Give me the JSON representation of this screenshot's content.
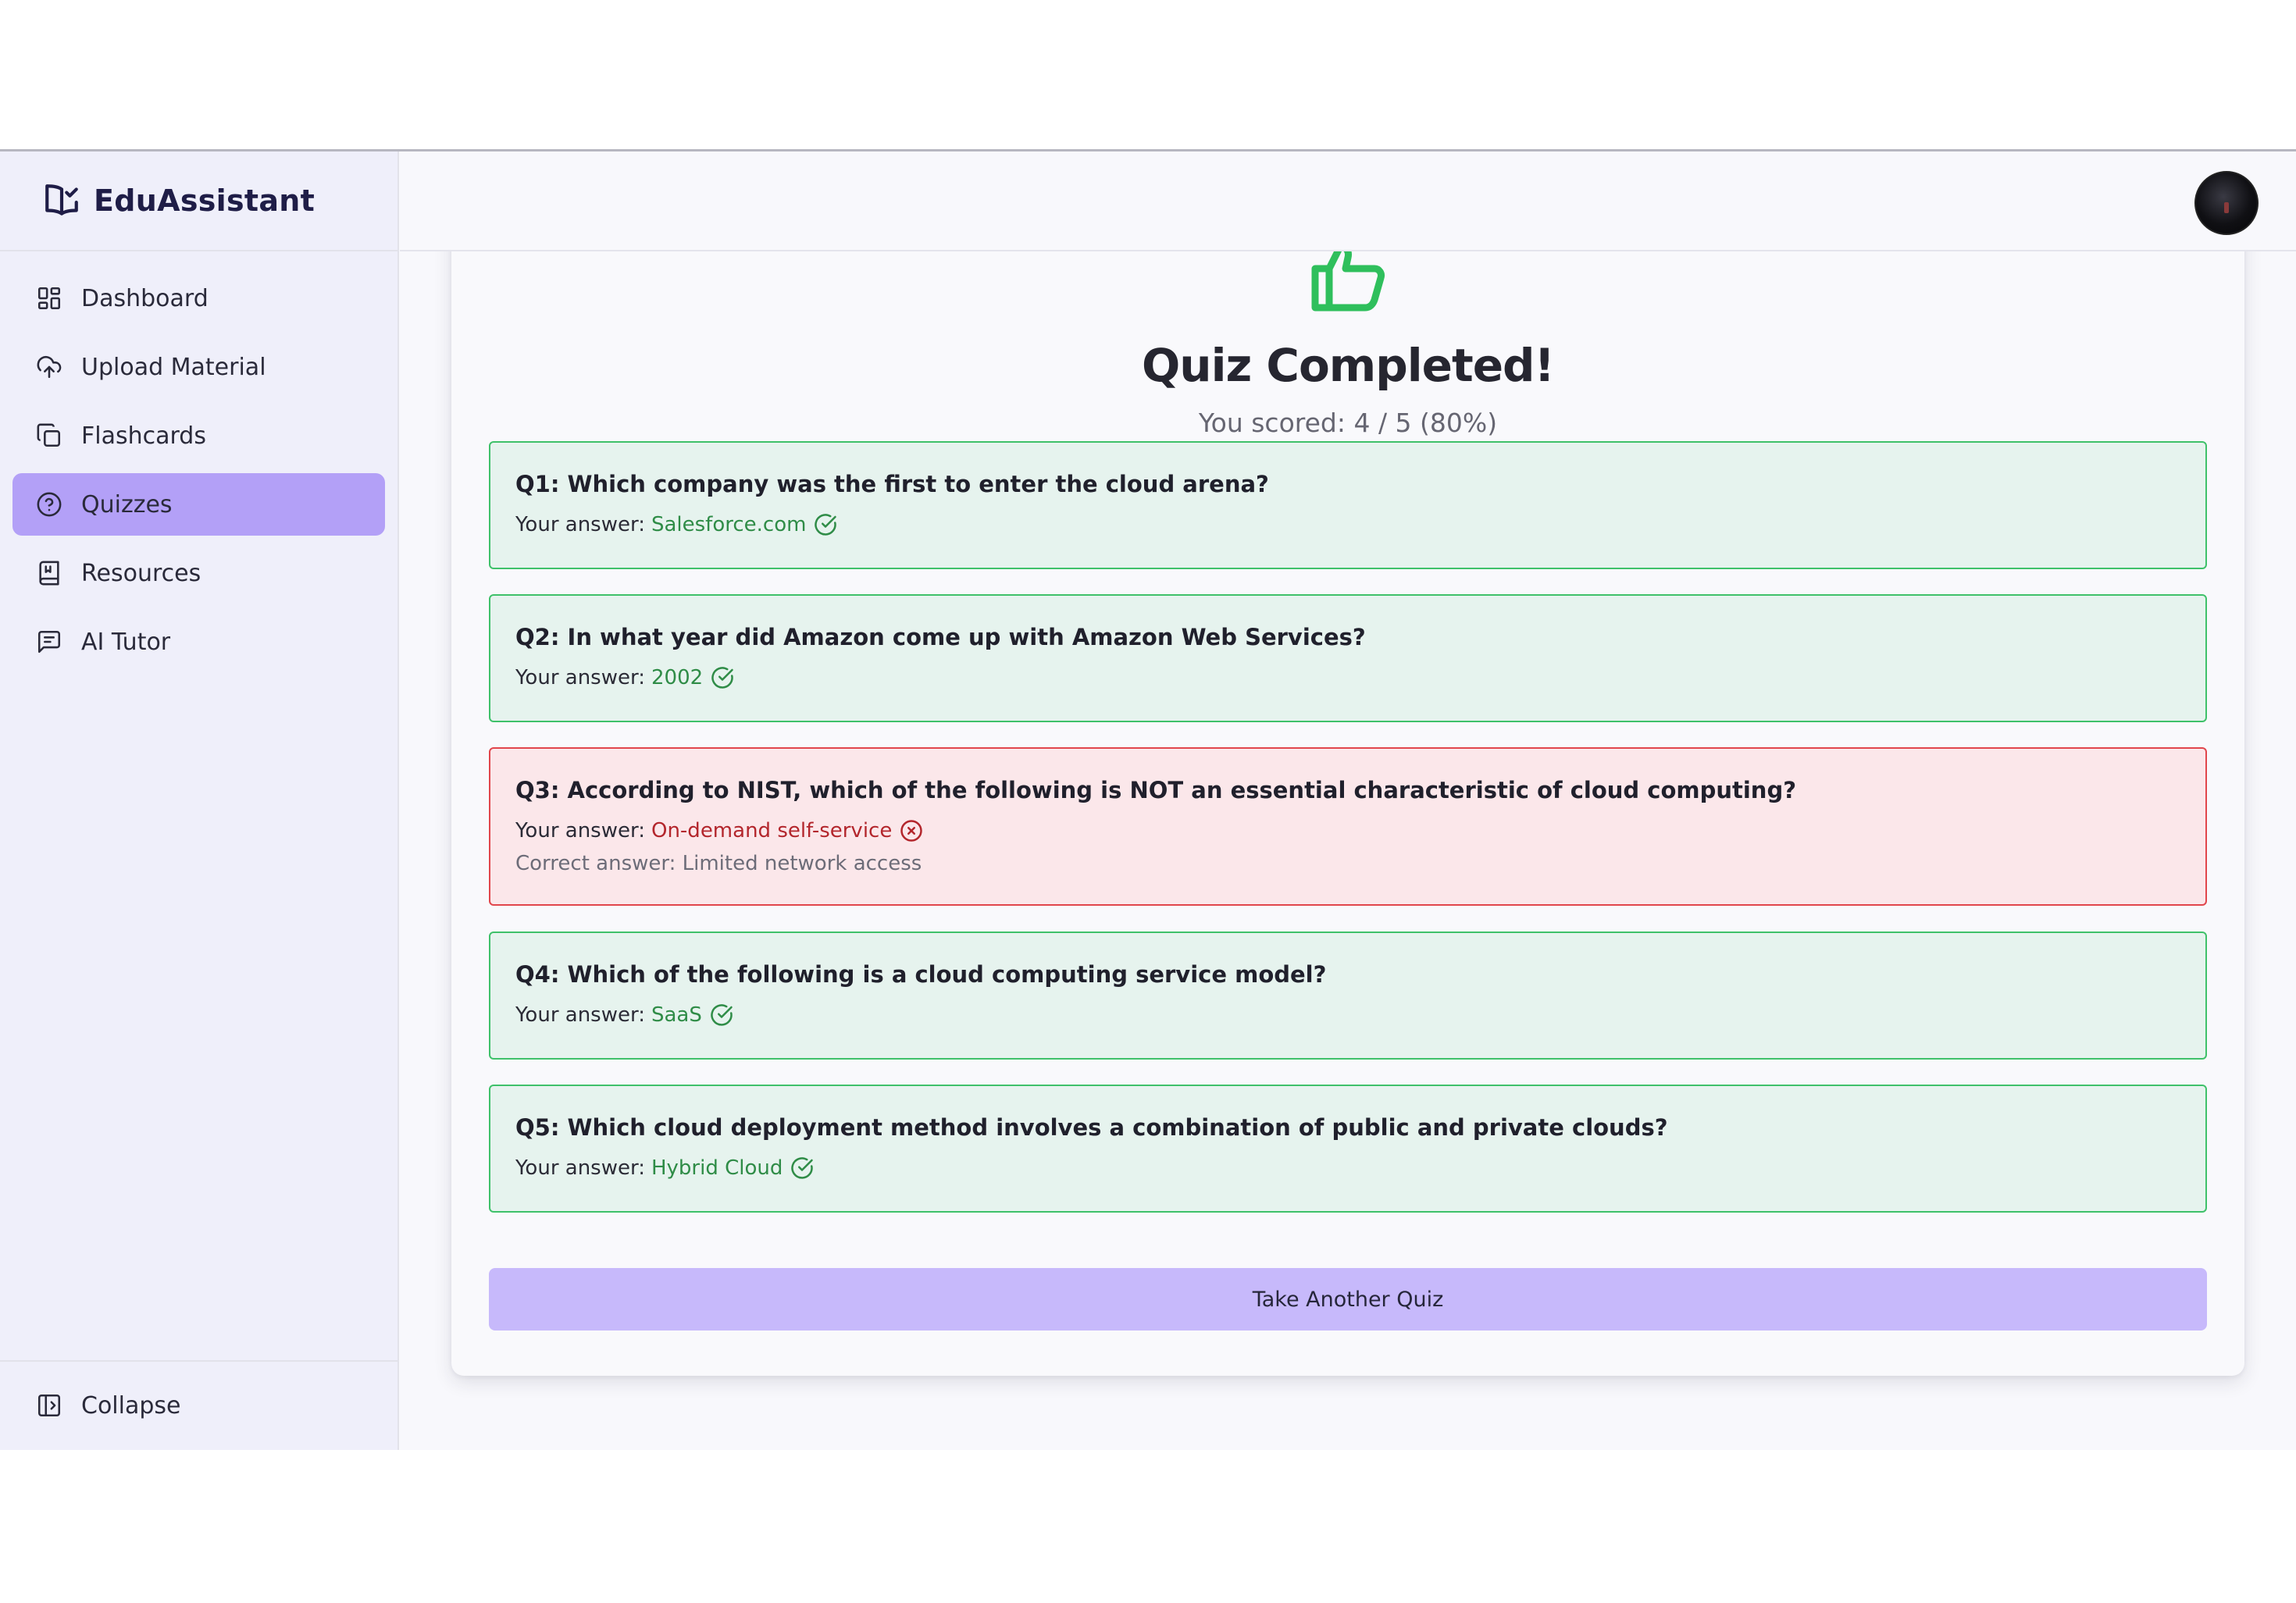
{
  "app": {
    "name": "EduAssistant",
    "logo_icon": "book-check-icon"
  },
  "sidebar": {
    "items": [
      {
        "label": "Dashboard",
        "icon": "dashboard-icon",
        "active": false
      },
      {
        "label": "Upload Material",
        "icon": "cloud-upload-icon",
        "active": false
      },
      {
        "label": "Flashcards",
        "icon": "copy-icon",
        "active": false
      },
      {
        "label": "Quizzes",
        "icon": "help-circle-icon",
        "active": true
      },
      {
        "label": "Resources",
        "icon": "book-icon",
        "active": false
      },
      {
        "label": "AI Tutor",
        "icon": "message-icon",
        "active": false
      }
    ],
    "collapse_label": "Collapse"
  },
  "colors": {
    "active_nav": "#b3a0f7",
    "correct_border": "#3fc16a",
    "correct_bg": "#e6f3ee",
    "wrong_border": "#e1464c",
    "wrong_bg": "#fbe7ea",
    "button": "#c7b9fb"
  },
  "quiz": {
    "title": "Quiz Completed!",
    "score_text": "You scored: 4 / 5 (80%)",
    "your_answer_label": "Your answer:",
    "questions": [
      {
        "text": "Q1: Which company was the first to enter the cloud arena?",
        "answer": "Salesforce.com",
        "correct": true
      },
      {
        "text": "Q2: In what year did Amazon come up with Amazon Web Services?",
        "answer": "2002",
        "correct": true
      },
      {
        "text": "Q3: According to NIST, which of the following is NOT an essential characteristic of cloud computing?",
        "answer": "On-demand self-service",
        "correct": false,
        "correct_answer_text": "Correct answer: Limited network access"
      },
      {
        "text": "Q4: Which of the following is a cloud computing service model?",
        "answer": "SaaS",
        "correct": true
      },
      {
        "text": "Q5: Which cloud deployment method involves a combination of public and private clouds?",
        "answer": "Hybrid Cloud",
        "correct": true
      }
    ],
    "button_label": "Take Another Quiz"
  }
}
